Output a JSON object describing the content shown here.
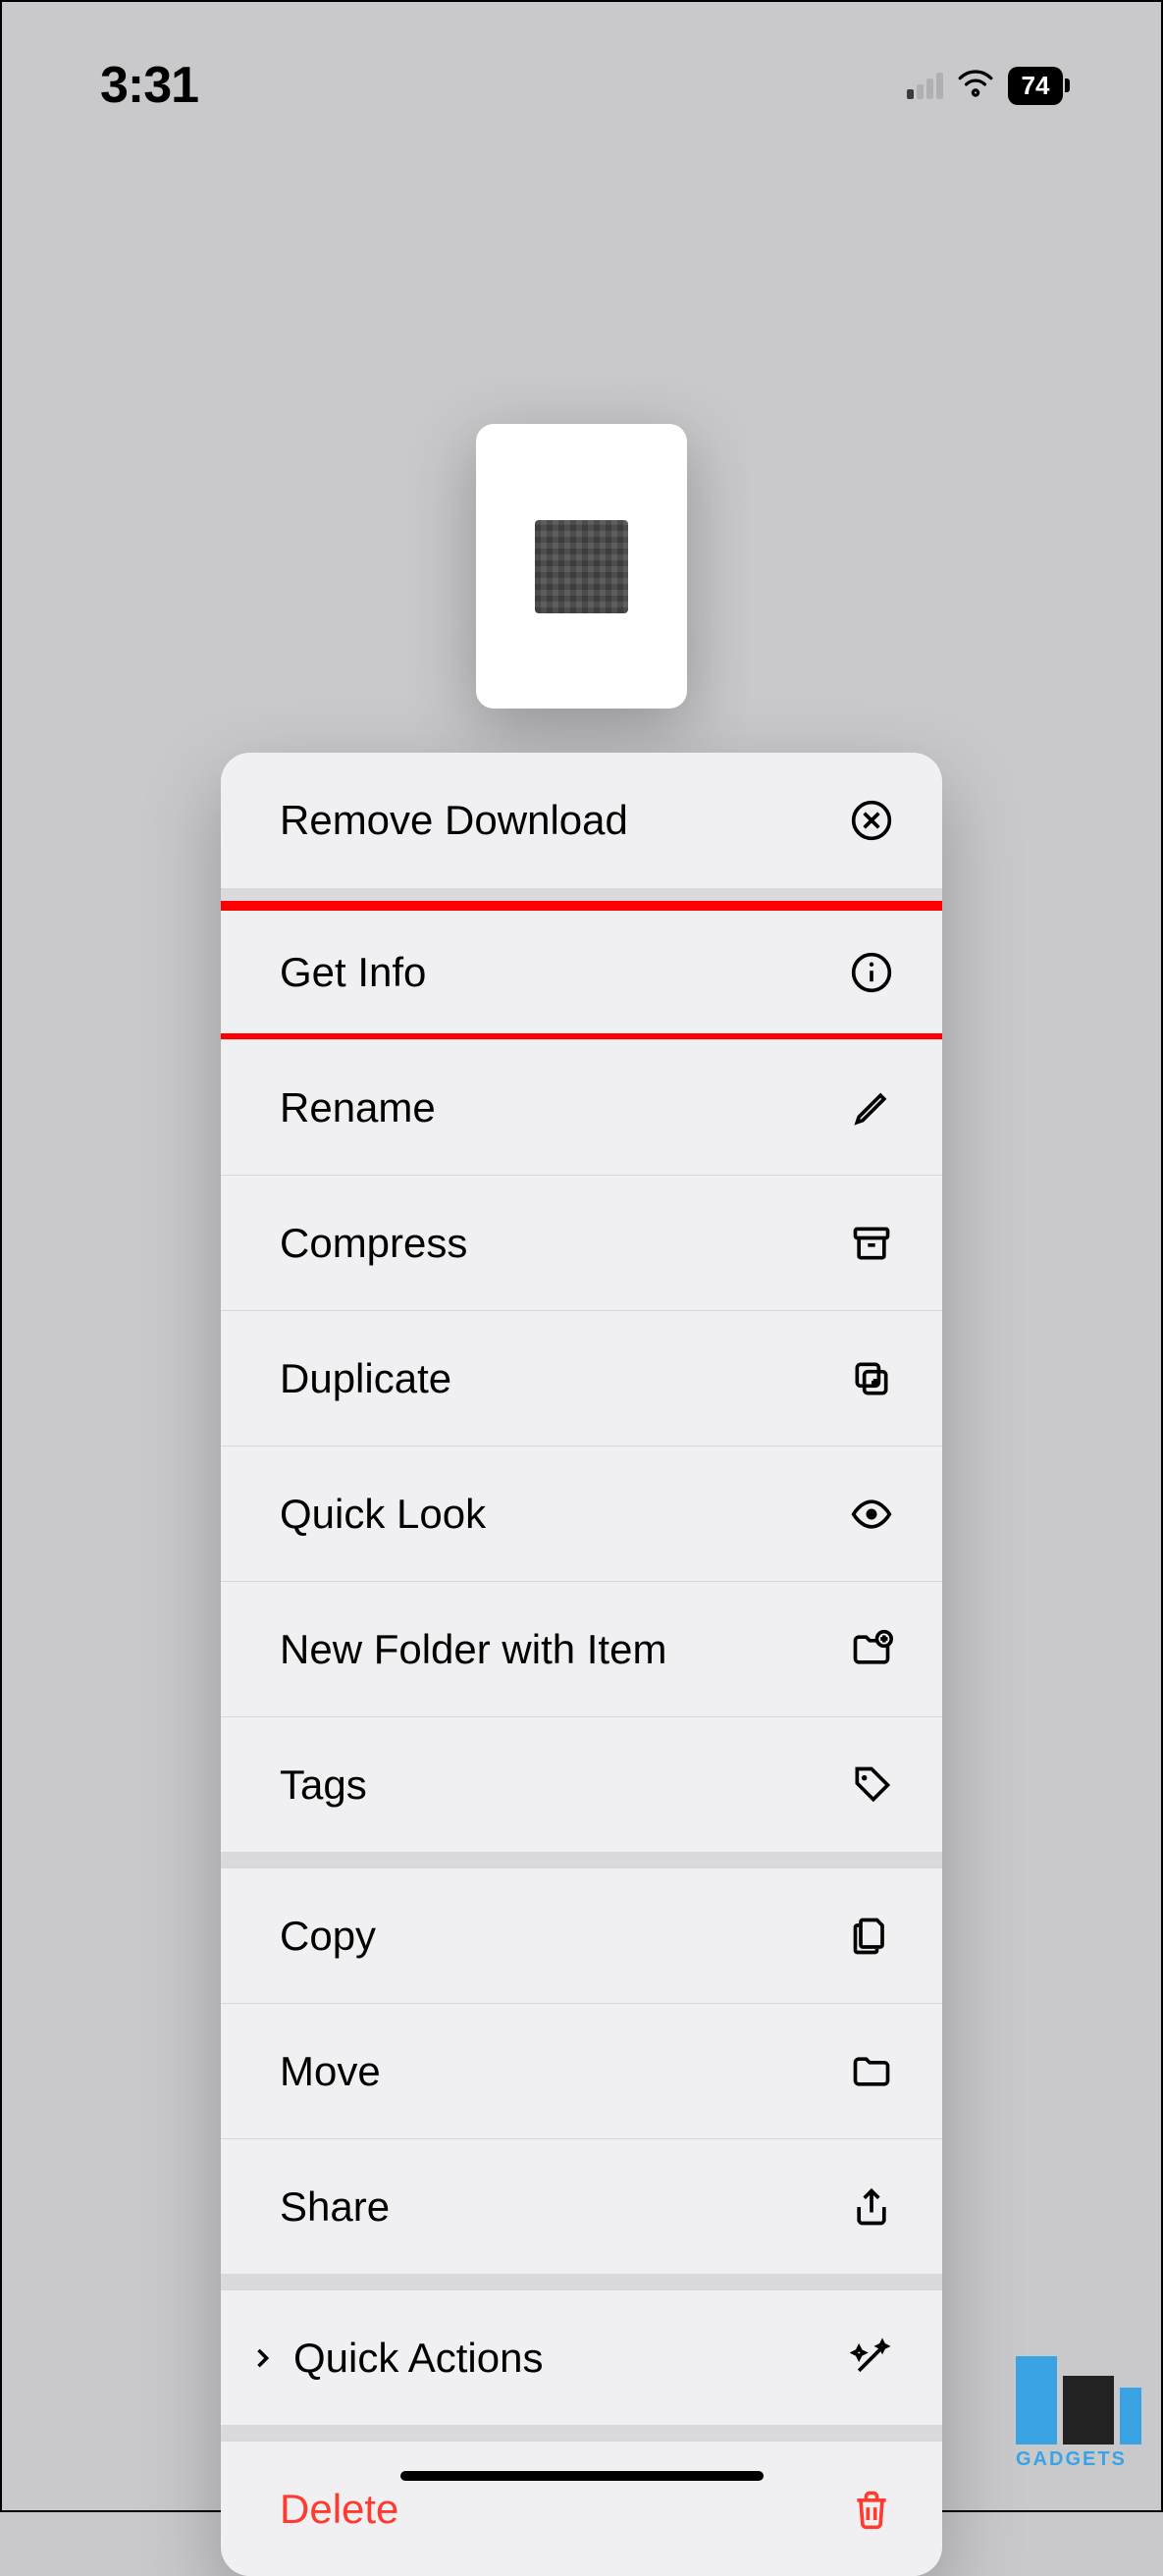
{
  "status": {
    "time": "3:31",
    "battery": "74"
  },
  "menu": {
    "remove_download": "Remove Download",
    "get_info": "Get Info",
    "rename": "Rename",
    "compress": "Compress",
    "duplicate": "Duplicate",
    "quick_look": "Quick Look",
    "new_folder": "New Folder with Item",
    "tags": "Tags",
    "copy": "Copy",
    "move": "Move",
    "share": "Share",
    "quick_actions": "Quick Actions",
    "delete": "Delete"
  },
  "watermark": {
    "text": "GADGETS"
  }
}
